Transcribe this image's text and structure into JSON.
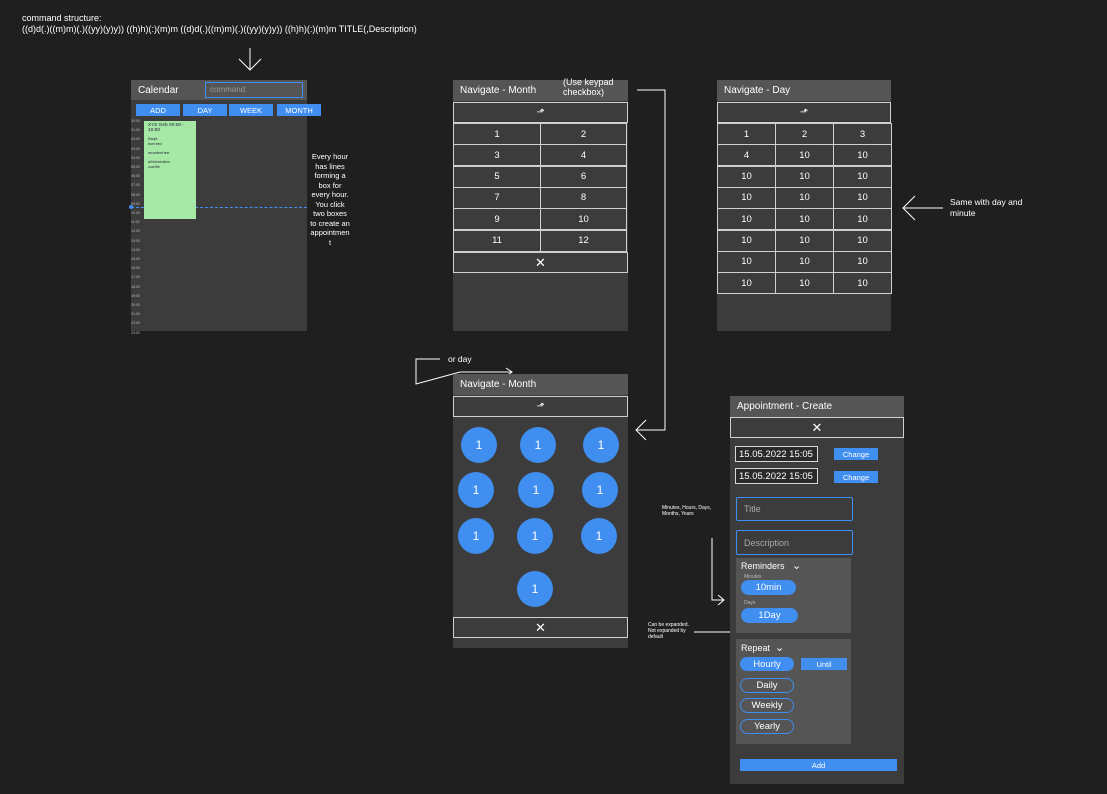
{
  "header": {
    "title": "command structure:",
    "syntax": "((d)d(.)((m)m)(.)((yy)(y)y)) ((h)h)(:)(m)m ((d)d(.)((m)m)(.)((yy)(y)y)) ((h)h)(:)(m)m TITLE(,Description)"
  },
  "calendar": {
    "title": "Calendar",
    "command_placeholder": "command",
    "buttons": [
      "ADD",
      "DAY",
      "WEEK",
      "MONTH"
    ],
    "hours": [
      "00:00",
      "01:00",
      "02:00",
      "03:00",
      "04:00",
      "05:00",
      "06:00",
      "07:00",
      "08:00",
      "09:00",
      "10:00",
      "11:00",
      "12:00",
      "13:00",
      "14:00",
      "15:00",
      "16:00",
      "17:00",
      "18:00",
      "19:00",
      "20:00",
      "21:00",
      "22:00",
      "23:00"
    ],
    "event": {
      "title": "XYZ Geb 00:00 - 10:50",
      "line1": "Ranpt",
      "line2": "hum bed",
      "line3": "recordent text",
      "line4": "all information",
      "line5": "cool file"
    }
  },
  "notes": {
    "hour_boxes": "Every hour has lines forming a box for every hour. You click two boxes to create an appointment",
    "same_day_minute": "Same with day and minute",
    "or_day": "or day",
    "minutes_list": "Minutes, Hours, Days, Months, Years",
    "expandable": "Can be expanded. Not expanded by default",
    "keypad": "(Use keypad checkbox)"
  },
  "nav_month": {
    "title": "Navigate - Month",
    "up_icon": "up-arrow-icon",
    "grid": [
      "1",
      "2",
      "3",
      "4",
      "5",
      "6",
      "7",
      "8",
      "9",
      "10",
      "11",
      "12"
    ],
    "close_icon": "close-icon"
  },
  "nav_day": {
    "title": "Navigate - Day",
    "up_icon": "up-arrow-icon",
    "grid": [
      "1",
      "2",
      "3",
      "4",
      "10",
      "10",
      "10",
      "10",
      "10",
      "10",
      "10",
      "10",
      "10",
      "10",
      "10",
      "10",
      "10",
      "10",
      "10",
      "10",
      "10",
      "10",
      "10",
      "10"
    ]
  },
  "nav_month2": {
    "title": "Navigate - Month",
    "circles": [
      "1",
      "1",
      "1",
      "1",
      "1",
      "1",
      "1",
      "1",
      "1",
      "1"
    ]
  },
  "appointment": {
    "title": "Appointment - Create",
    "start": "15.05.2022 15:05",
    "end": "15.05.2022 15:05",
    "change_label": "Change",
    "title_placeholder": "Title",
    "description_placeholder": "Description",
    "reminders_label": "Reminders",
    "minutes_label": "Minutes",
    "minutes_value": "10min",
    "days_label": "Days",
    "days_value": "1Day",
    "repeat_label": "Repeat",
    "repeat_options": [
      "Hourly",
      "Daily",
      "Weekly",
      "Yearly"
    ],
    "until_label": "Until",
    "add_label": "Add"
  },
  "colors": {
    "accent": "#3f8ef0",
    "panel": "#3c3c3c",
    "title_bar": "#555555",
    "event": "#a6e8a6",
    "background": "#1f1f1f"
  }
}
